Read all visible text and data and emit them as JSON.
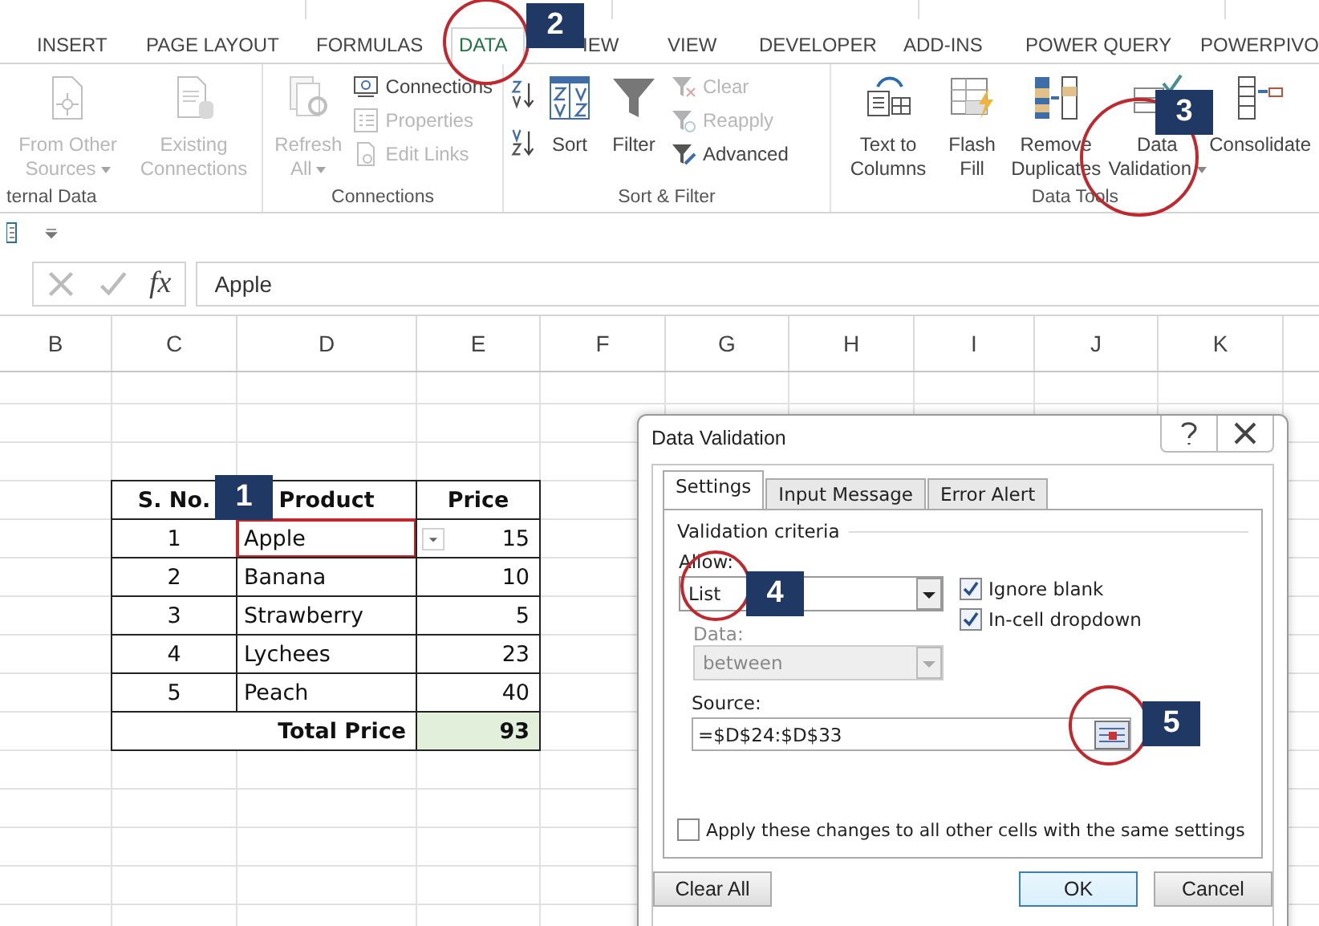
{
  "ribbon_tabs": [
    {
      "label": "INSERT",
      "selected": false
    },
    {
      "label": "PAGE LAYOUT",
      "selected": false
    },
    {
      "label": "FORMULAS",
      "selected": false
    },
    {
      "label": "DATA",
      "selected": true
    },
    {
      "label": "IEW",
      "selected": false
    },
    {
      "label": "VIEW",
      "selected": false
    },
    {
      "label": "DEVELOPER",
      "selected": false
    },
    {
      "label": "ADD-INS",
      "selected": false
    },
    {
      "label": "POWER QUERY",
      "selected": false
    },
    {
      "label": "POWERPIVO",
      "selected": false
    }
  ],
  "ribbon_groups": [
    {
      "label": "ternal Data",
      "items": [
        {
          "kind": "large",
          "label": "From Other Sources",
          "dropdown": true,
          "disabled": true
        },
        {
          "kind": "large",
          "label": "Existing Connections",
          "dropdown": false,
          "disabled": true
        }
      ]
    },
    {
      "label": "Connections",
      "items": [
        {
          "kind": "large",
          "label": "Refresh All",
          "dropdown": true,
          "disabled": true
        },
        {
          "kind": "small",
          "label": "Connections",
          "disabled": false
        },
        {
          "kind": "small",
          "label": "Properties",
          "disabled": true
        },
        {
          "kind": "small",
          "label": "Edit Links",
          "disabled": true
        }
      ]
    },
    {
      "label": "Sort & Filter",
      "items": [
        {
          "kind": "sortpair"
        },
        {
          "kind": "large",
          "label": "Sort",
          "dropdown": false,
          "disabled": false
        },
        {
          "kind": "large",
          "label": "Filter",
          "dropdown": false,
          "disabled": false
        },
        {
          "kind": "small",
          "label": "Clear",
          "disabled": true
        },
        {
          "kind": "small",
          "label": "Reapply",
          "disabled": true
        },
        {
          "kind": "small",
          "label": "Advanced",
          "disabled": false
        }
      ]
    },
    {
      "label": "Data Tools",
      "items": [
        {
          "kind": "large",
          "label": "Text to Columns",
          "dropdown": false,
          "disabled": false
        },
        {
          "kind": "large",
          "label": "Flash Fill",
          "dropdown": false,
          "disabled": false
        },
        {
          "kind": "large",
          "label": "Remove Duplicates",
          "dropdown": false,
          "disabled": false
        },
        {
          "kind": "large",
          "label": "Data Validation",
          "dropdown": true,
          "disabled": false
        },
        {
          "kind": "large",
          "label": "Consolidate",
          "dropdown": false,
          "disabled": false
        }
      ]
    }
  ],
  "formula_bar": {
    "function_label": "fx",
    "value": "Apple"
  },
  "columns": [
    "B",
    "C",
    "D",
    "E",
    "F",
    "G",
    "H",
    "I",
    "J",
    "K"
  ],
  "table": {
    "headers": [
      "S. No.",
      "Product",
      "Price"
    ],
    "rows": [
      {
        "no": "1",
        "product": "Apple",
        "price": "15",
        "selected": true
      },
      {
        "no": "2",
        "product": "Banana",
        "price": "10",
        "selected": false
      },
      {
        "no": "3",
        "product": "Strawberry",
        "price": "5",
        "selected": false
      },
      {
        "no": "4",
        "product": "Lychees",
        "price": "23",
        "selected": false
      },
      {
        "no": "5",
        "product": "Peach",
        "price": "40",
        "selected": false
      }
    ],
    "total_label": "Total Price",
    "total": "93"
  },
  "dialog": {
    "title": "Data Validation",
    "tabs": [
      {
        "label": "Settings",
        "selected": true
      },
      {
        "label": "Input Message",
        "selected": false
      },
      {
        "label": "Error Alert",
        "selected": false
      }
    ],
    "section": "Validation criteria",
    "allow_label": "Allow:",
    "allow_value": "List",
    "data_label": "Data:",
    "data_value": "between",
    "data_disabled": true,
    "checkboxes": [
      {
        "label": "Ignore blank",
        "checked": true
      },
      {
        "label": "In-cell dropdown",
        "checked": true
      }
    ],
    "source_label": "Source:",
    "source_value": "=$D$24:$D$33",
    "apply_all": {
      "label": "Apply these changes to all other cells with the same settings",
      "checked": false
    },
    "buttons": [
      {
        "label": "Clear All",
        "default": false
      },
      {
        "label": "OK",
        "default": true
      },
      {
        "label": "Cancel",
        "default": false
      }
    ]
  },
  "callouts": [
    "1",
    "2",
    "3",
    "4",
    "5"
  ]
}
